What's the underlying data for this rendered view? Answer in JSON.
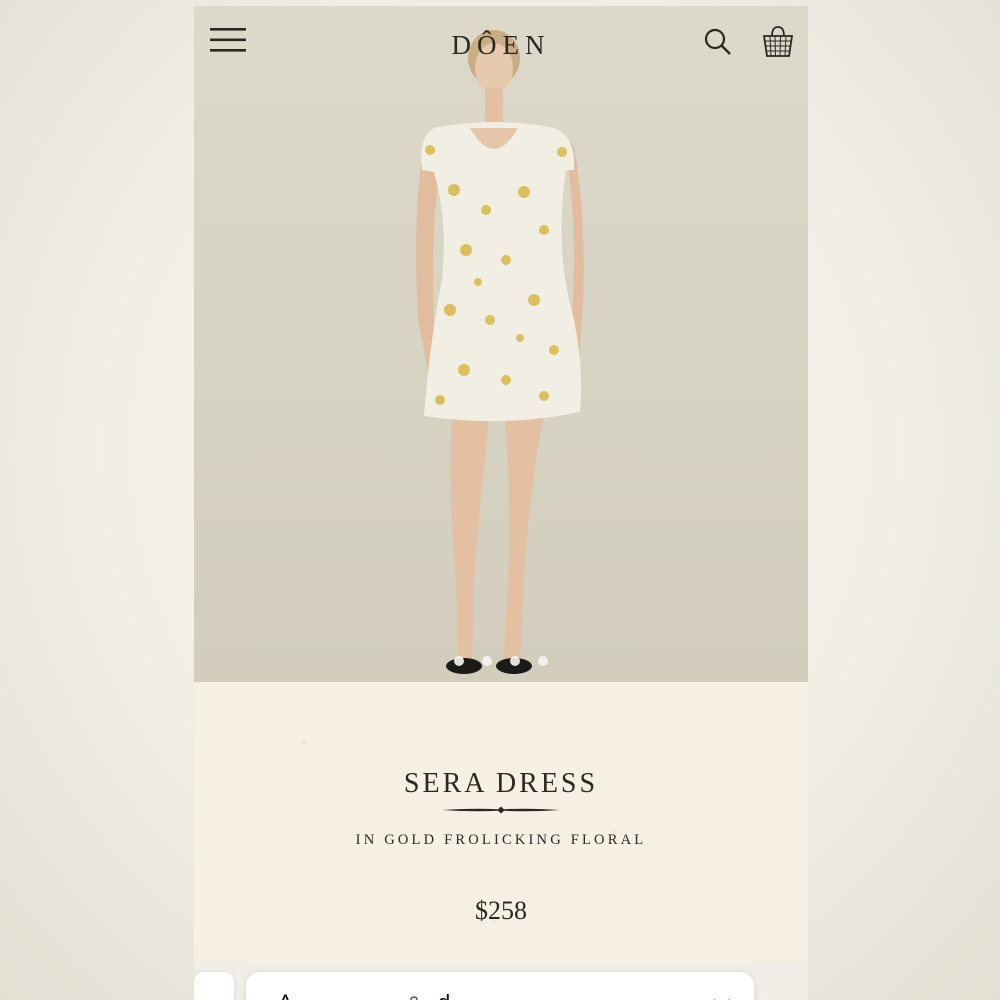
{
  "header": {
    "logo": "DÔEN",
    "menu_icon": "hamburger-menu-icon",
    "search_icon": "search-icon",
    "bag_icon": "shopping-bag-icon"
  },
  "gallery": {
    "image_alt": "Model wearing the Sera Dress in Gold Frolicking Floral",
    "slide_count": 4,
    "active_slide": 1
  },
  "product": {
    "name": "SERA DRESS",
    "variant": "IN GOLD FROLICKING FLORAL",
    "price": "$258"
  },
  "browser": {
    "text_size_label": "A",
    "url_partial": "d",
    "lock_icon": "lock-icon",
    "close_icon": "close-icon"
  },
  "colors": {
    "text": "#2b2822",
    "hero_bg": "#d8d5c6",
    "info_bg": "#f5f0e3"
  }
}
